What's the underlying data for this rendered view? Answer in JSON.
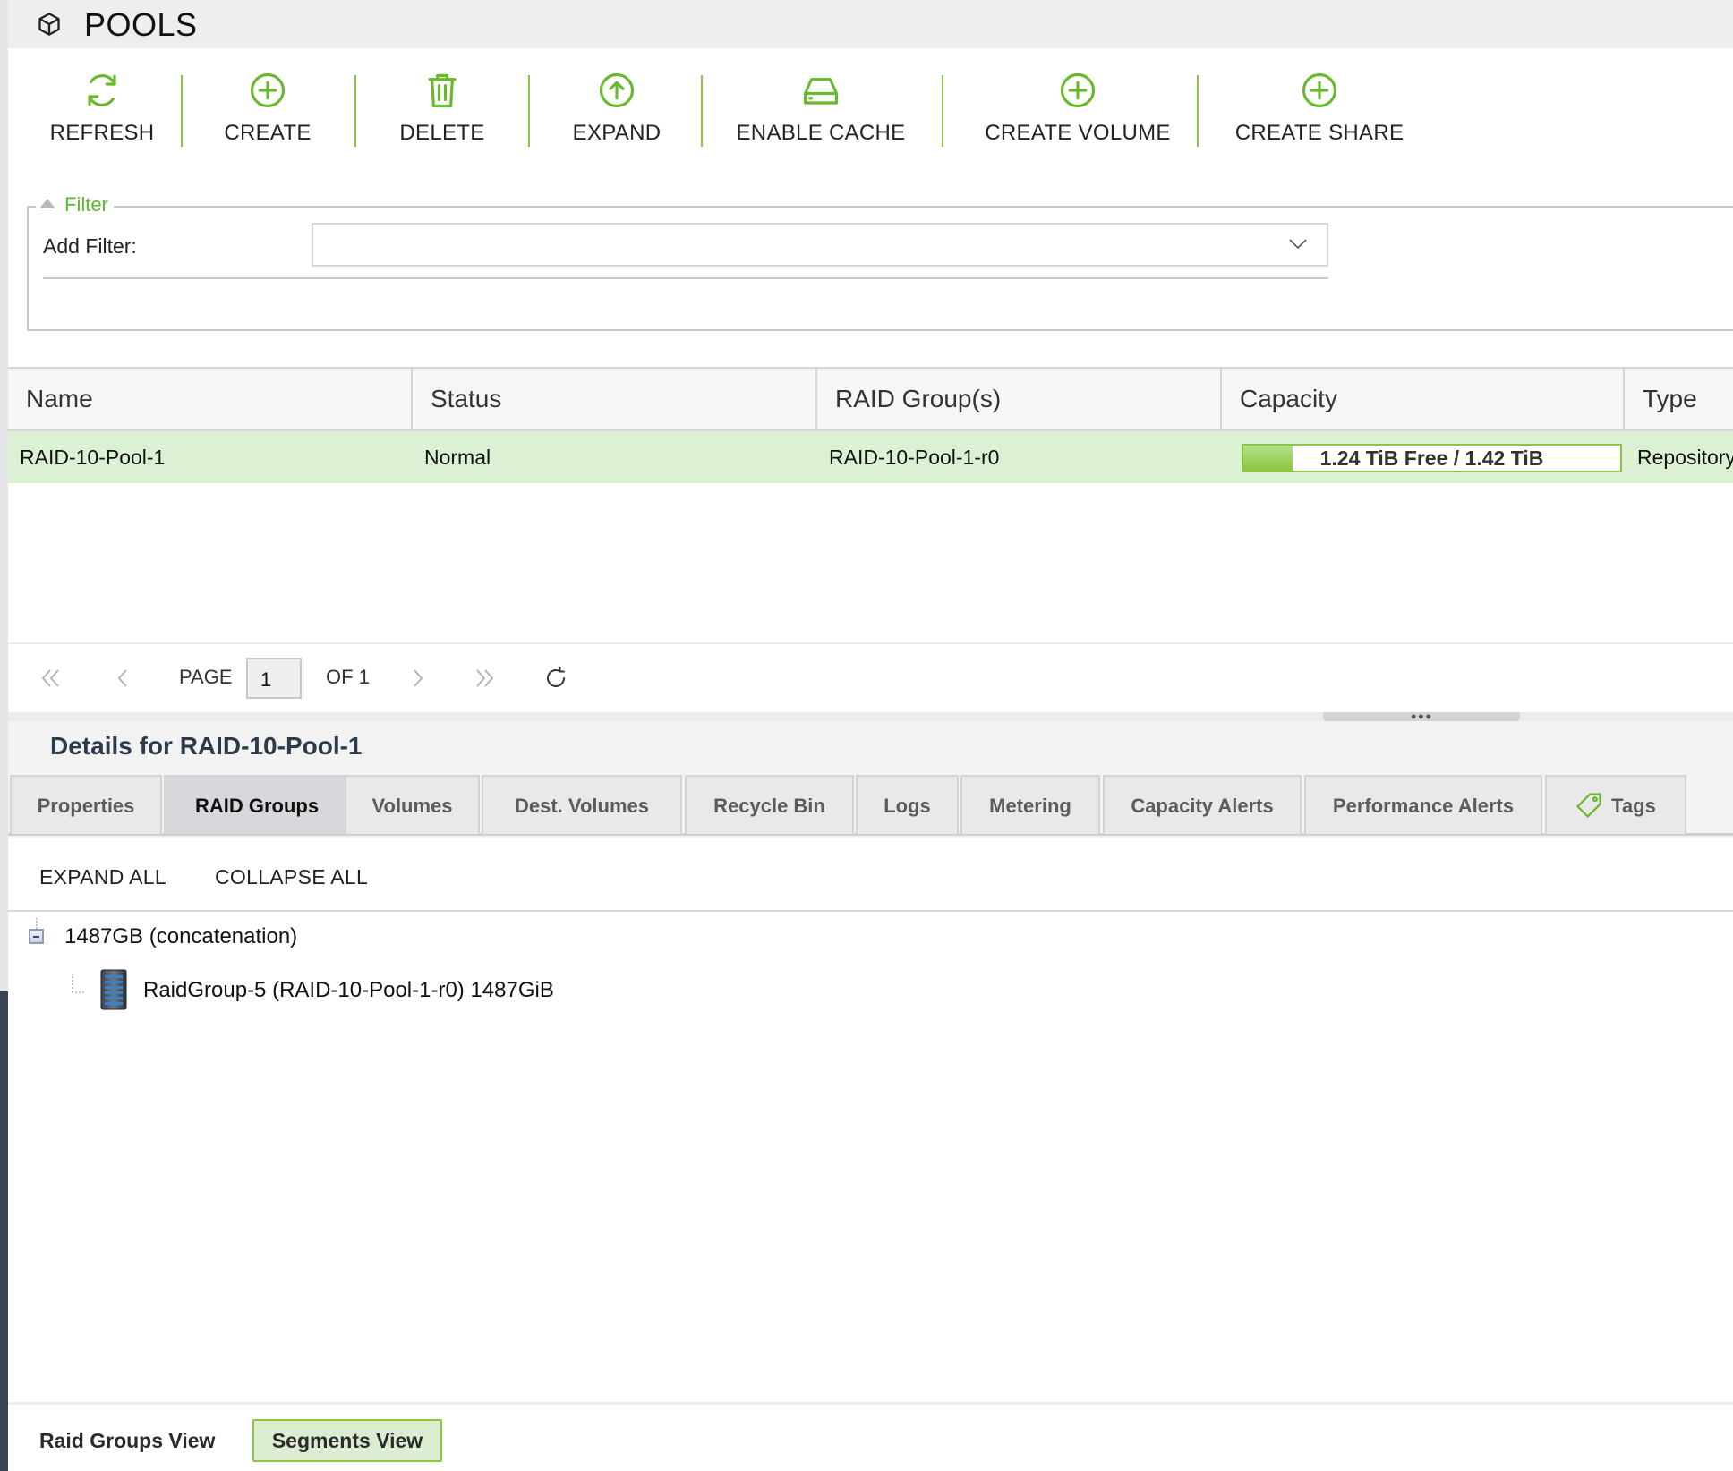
{
  "title": "POOLS",
  "toolbar": {
    "refresh": "REFRESH",
    "create": "CREATE",
    "delete": "DELETE",
    "expand": "EXPAND",
    "enable_cache": "ENABLE CACHE",
    "create_volume": "CREATE VOLUME",
    "create_share": "CREATE SHARE"
  },
  "filter": {
    "legend": "Filter",
    "add_filter_label": "Add Filter:",
    "value": ""
  },
  "grid": {
    "columns": [
      "Name",
      "Status",
      "RAID Group(s)",
      "Capacity",
      "Type"
    ],
    "rows": [
      {
        "name": "RAID-10-Pool-1",
        "status": "Normal",
        "raid_groups": "RAID-10-Pool-1-r0",
        "capacity_text": "1.24 TiB Free / 1.42 TiB",
        "capacity_used_fraction": 0.13,
        "type": "Repository"
      }
    ]
  },
  "pager": {
    "page_label": "PAGE",
    "page_value": "1",
    "of_label": "OF 1"
  },
  "details": {
    "title": "Details for RAID-10-Pool-1",
    "tabs": [
      "Properties",
      "RAID Groups",
      "Volumes",
      "Dest. Volumes",
      "Recycle Bin",
      "Logs",
      "Metering",
      "Capacity Alerts",
      "Performance Alerts",
      "Tags"
    ],
    "active_tab": "RAID Groups",
    "expand_all": "EXPAND ALL",
    "collapse_all": "COLLAPSE ALL",
    "tree": {
      "root": "1487GB (concatenation)",
      "child": "RaidGroup-5 (RAID-10-Pool-1-r0) 1487GiB"
    },
    "view_buttons": {
      "raid_groups_view": "Raid Groups View",
      "segments_view": "Segments View"
    }
  },
  "colors": {
    "accent_green": "#8cc63f",
    "selected_row": "#dcf0d4",
    "legend_text": "#5fb834"
  }
}
